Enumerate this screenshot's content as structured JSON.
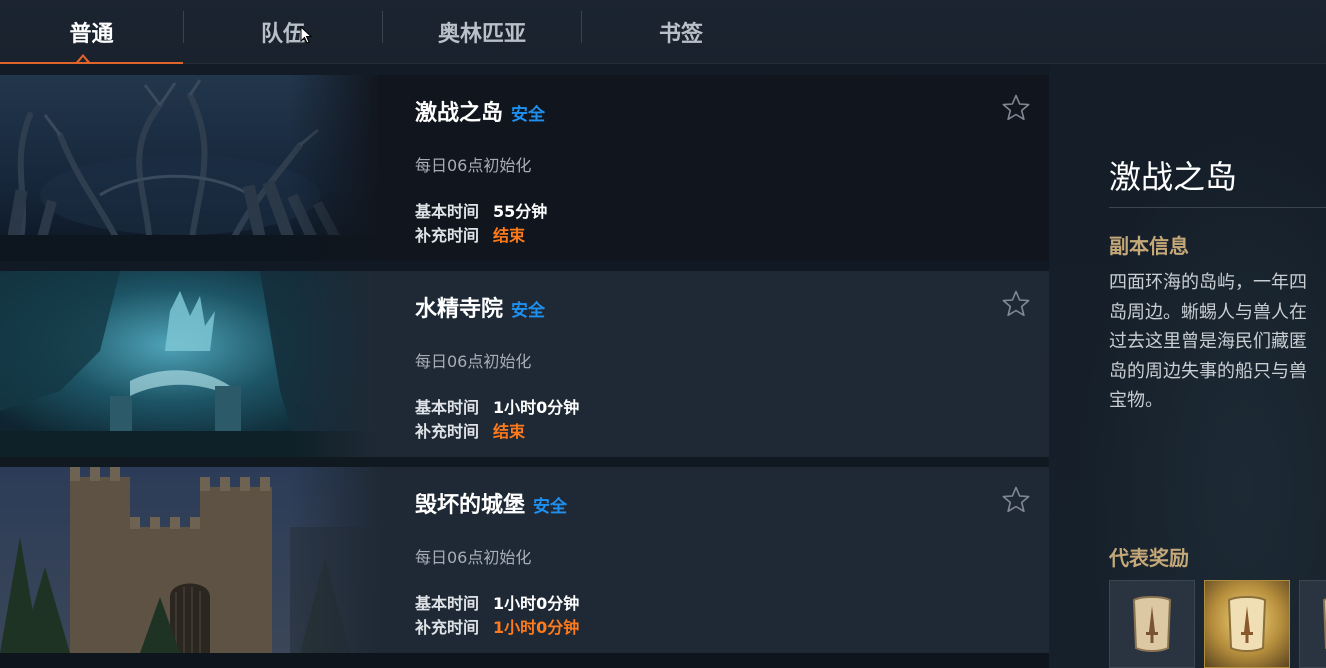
{
  "tabs": [
    {
      "label": "普通",
      "active": true
    },
    {
      "label": "队伍",
      "active": false
    },
    {
      "label": "奥林匹亚",
      "active": false
    },
    {
      "label": "书签",
      "active": false
    }
  ],
  "dungeons": [
    {
      "name": "激战之岛",
      "safety": "安全",
      "reset": "每日06点初始化",
      "base_time_label": "基本时间",
      "base_time": "55分钟",
      "extra_time_label": "补充时间",
      "extra_time": "结束",
      "selected": true,
      "bookmarked": false
    },
    {
      "name": "水精寺院",
      "safety": "安全",
      "reset": "每日06点初始化",
      "base_time_label": "基本时间",
      "base_time": "1小时0分钟",
      "extra_time_label": "补充时间",
      "extra_time": "结束",
      "selected": false,
      "bookmarked": false
    },
    {
      "name": "毁坏的城堡",
      "safety": "安全",
      "reset": "每日06点初始化",
      "base_time_label": "基本时间",
      "base_time": "1小时0分钟",
      "extra_time_label": "补充时间",
      "extra_time": "1小时0分钟",
      "selected": false,
      "bookmarked": false
    }
  ],
  "detail": {
    "title": "激战之岛",
    "info_heading": "副本信息",
    "description_lines": [
      "四面环海的岛屿，一年四",
      "岛周边。蜥蜴人与兽人在",
      "过去这里曾是海民们藏匿",
      "岛的周边失事的船只与兽",
      "宝物。"
    ],
    "rewards_heading": "代表奖励",
    "rewards": [
      {
        "icon": "scroll-icon",
        "highlight": false
      },
      {
        "icon": "scroll-icon",
        "highlight": true
      },
      {
        "icon": "scroll-icon",
        "highlight": false
      }
    ]
  },
  "colors": {
    "accent": "#e0652a",
    "safe": "#1e90f0",
    "time_warning": "#ff7a1a",
    "section_heading": "#c4a878"
  }
}
